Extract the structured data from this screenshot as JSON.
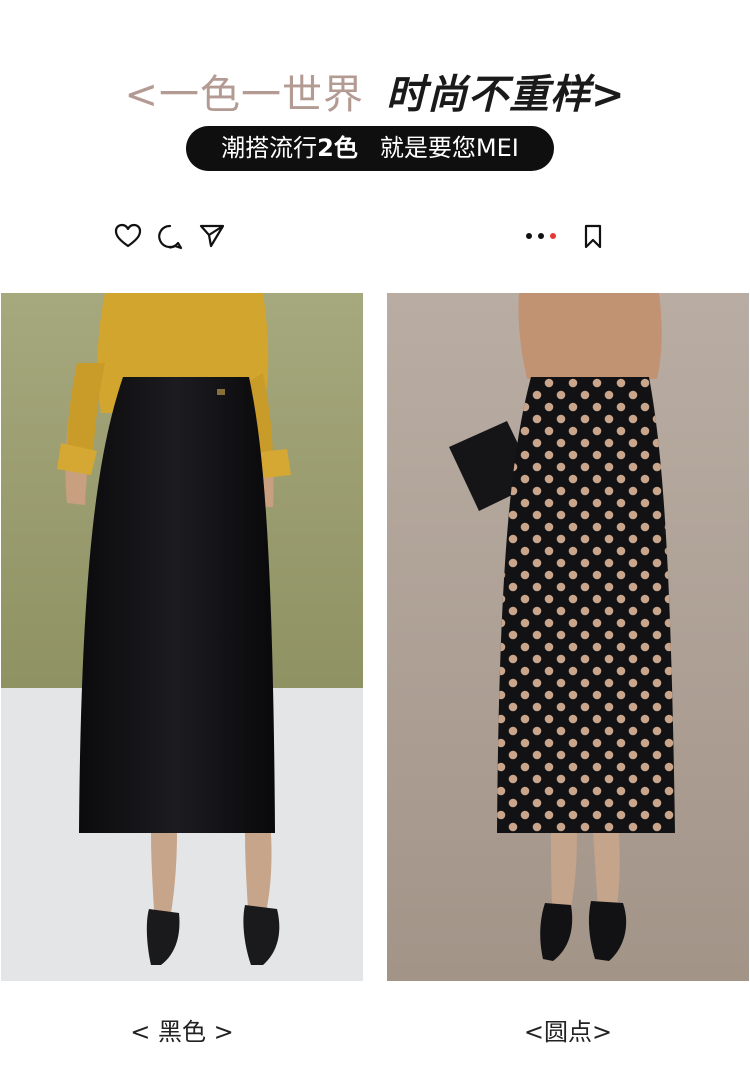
{
  "header": {
    "title_left": "<一色一世界",
    "title_right": "时尚不重样>",
    "badge_part1": "潮搭流行",
    "badge_part2": "2色",
    "badge_part3": "就是要您MEI"
  },
  "social_icons": [
    "heart-icon",
    "comment-icon",
    "share-icon",
    "more-dots-icon",
    "bookmark-icon"
  ],
  "products": [
    {
      "caption": "< 黑色 >",
      "image": "black-velvet-skirt-photo"
    },
    {
      "caption": "<圆点>",
      "image": "polka-dot-skirt-photo"
    }
  ],
  "colors": {
    "title_left": "#b39b93",
    "pill_bg": "#0f0f0f",
    "dot_accent": "#e53935",
    "polka_dot": "#c9a58c"
  }
}
